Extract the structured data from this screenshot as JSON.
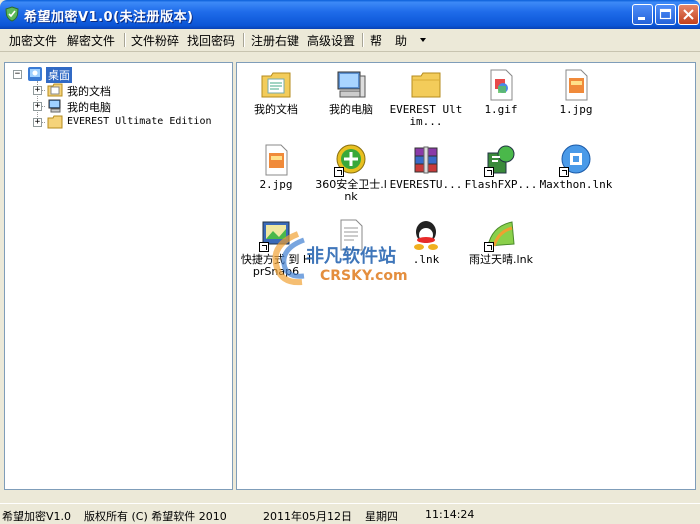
{
  "window": {
    "title": "希望加密V1.0(未注册版本)"
  },
  "toolbar": {
    "items": [
      "加密文件",
      "解密文件",
      "文件粉碎",
      "找回密码",
      "注册右键",
      "高级设置",
      "帮",
      "助"
    ]
  },
  "tree": {
    "root": "桌面",
    "children": [
      "我的文档",
      "我的电脑",
      "EVEREST Ultimate Edition"
    ]
  },
  "files": [
    {
      "label": "我的文档",
      "icon": "my-documents-icon"
    },
    {
      "label": "我的电脑",
      "icon": "my-computer-icon"
    },
    {
      "label": "EVEREST Ultim...",
      "icon": "folder-icon"
    },
    {
      "label": "1.gif",
      "icon": "gif-file-icon"
    },
    {
      "label": "1.jpg",
      "icon": "jpg-file-icon"
    },
    {
      "label": "2.jpg",
      "icon": "jpg-file-icon"
    },
    {
      "label": "360安全卫士.lnk",
      "icon": "360-security-icon"
    },
    {
      "label": "EVERESTU...",
      "icon": "winrar-archive-icon"
    },
    {
      "label": "FlashFXP...",
      "icon": "flashfxp-icon"
    },
    {
      "label": "Maxthon.lnk",
      "icon": "maxthon-icon"
    },
    {
      "label": "快捷方式 到 HprSnap6",
      "icon": "hypersnap-icon"
    },
    {
      "label": "",
      "icon": "text-file-icon"
    },
    {
      "label": ".lnk",
      "icon": "qq-icon"
    },
    {
      "label": "雨过天晴.lnk",
      "icon": "rain-sky-icon"
    }
  ],
  "watermark": {
    "text": "非凡软件站",
    "sub": "CRSKY.com"
  },
  "status": {
    "app": "希望加密V1.0",
    "copyright": "版权所有 (C) 希望软件 2010",
    "date": "2011年05月12日",
    "weekday": "星期四",
    "time": "11:14:24"
  },
  "colors": {
    "titlebar": "#0b55d6",
    "selection": "#316ac5",
    "watermark_blue": "#1e5fae",
    "watermark_orange": "#e07b1d"
  }
}
